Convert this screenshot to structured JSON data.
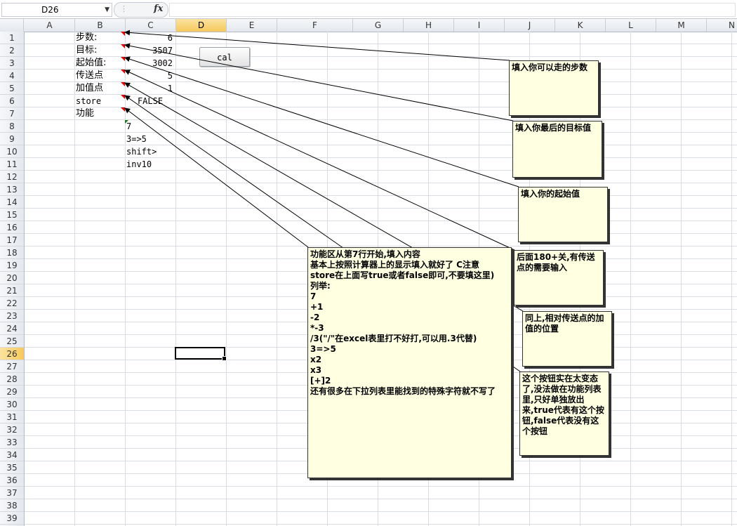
{
  "formula_bar": {
    "name_box": "D26",
    "fx_label": "fx",
    "formula": ""
  },
  "columns": [
    "A",
    "B",
    "C",
    "D",
    "E",
    "F",
    "G",
    "H",
    "I",
    "J",
    "K",
    "L",
    "M",
    "N"
  ],
  "selected_column": "D",
  "rows": [
    "1",
    "2",
    "3",
    "4",
    "5",
    "6",
    "7",
    "8",
    "9",
    "10",
    "11",
    "12",
    "13",
    "14",
    "15",
    "16",
    "17",
    "18",
    "19",
    "20",
    "21",
    "22",
    "23",
    "24",
    "25",
    "26",
    "27",
    "28",
    "29",
    "30",
    "31",
    "32",
    "33",
    "34",
    "35",
    "36",
    "37",
    "38",
    "39"
  ],
  "selected_row": "26",
  "cells": {
    "b1": "步数:",
    "b2": "目标:",
    "b3": "起始值:",
    "b4": "传送点",
    "b5": "加值点",
    "b6": "store",
    "b7": "功能",
    "c1": "6",
    "c2": "3507",
    "c3": "3002",
    "c4": "5",
    "c5": "1",
    "c6": "FALSE",
    "c8": "7",
    "c9": "3=>5",
    "c10": "shift>",
    "c11": "inv10"
  },
  "button": {
    "cal_label": "cal"
  },
  "comments": {
    "steps": "填入你可以走的步数",
    "target": "填入你最后的目标值",
    "start": "填入你的起始值",
    "portal": "后面180+关,有传送点的需要输入",
    "add": "同上,相对传送点的加值的位置",
    "store": "这个按钮实在太变态了,没法做在功能列表里,只好单独放出来,true代表有这个按钮,false代表没有这个按钮",
    "function": "功能区从第7行开始,填入内容\n基本上按照计算器上的显示填入就好了 C注意\nstore在上面写true或者false即可,不要填这里)\n列举:\n7\n+1\n-2\n*-3\n/3(\"/\"在excel表里打不好打,可以用.3代替)\n3=>5\nx2\nx3\n[+]2\n还有很多在下拉列表里能找到的特殊字符就不写了"
  },
  "colors": {
    "comment_bg": "#ffffe1",
    "comment_indicator": "#dd0000",
    "header_selected": "#f6c95c"
  }
}
